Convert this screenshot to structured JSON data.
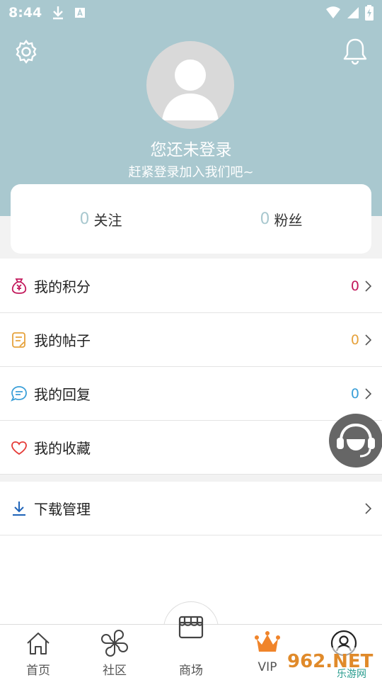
{
  "status_bar": {
    "time": "8:44"
  },
  "header": {
    "title": "您还未登录",
    "subtitle": "赶紧登录加入我们吧~",
    "accent": "#a9c8cf",
    "icons": {
      "settings": "gear-icon",
      "notifications": "bell-icon",
      "avatar": "person-icon"
    }
  },
  "stats": [
    {
      "count": "0",
      "label": "关注"
    },
    {
      "count": "0",
      "label": "粉丝"
    }
  ],
  "menu": [
    {
      "label": "我的积分",
      "count": "0",
      "color": "#c2185b",
      "icon": "money-bag-icon"
    },
    {
      "label": "我的帖子",
      "count": "0",
      "color": "#e6a23c",
      "icon": "note-icon"
    },
    {
      "label": "我的回复",
      "count": "0",
      "color": "#3a9fd8",
      "icon": "chat-bubble-icon"
    },
    {
      "label": "我的收藏",
      "color": "#e53935",
      "icon": "heart-icon"
    }
  ],
  "menu_extra": {
    "label": "下载管理",
    "color": "#1e63b8",
    "icon": "download-icon"
  },
  "tabbar": {
    "home": "首页",
    "community": "社区",
    "shop": "商场",
    "vip": "VIP",
    "vip_color": "#f0842a"
  },
  "watermark": {
    "text": "962.NET",
    "subtext": "乐游网"
  }
}
